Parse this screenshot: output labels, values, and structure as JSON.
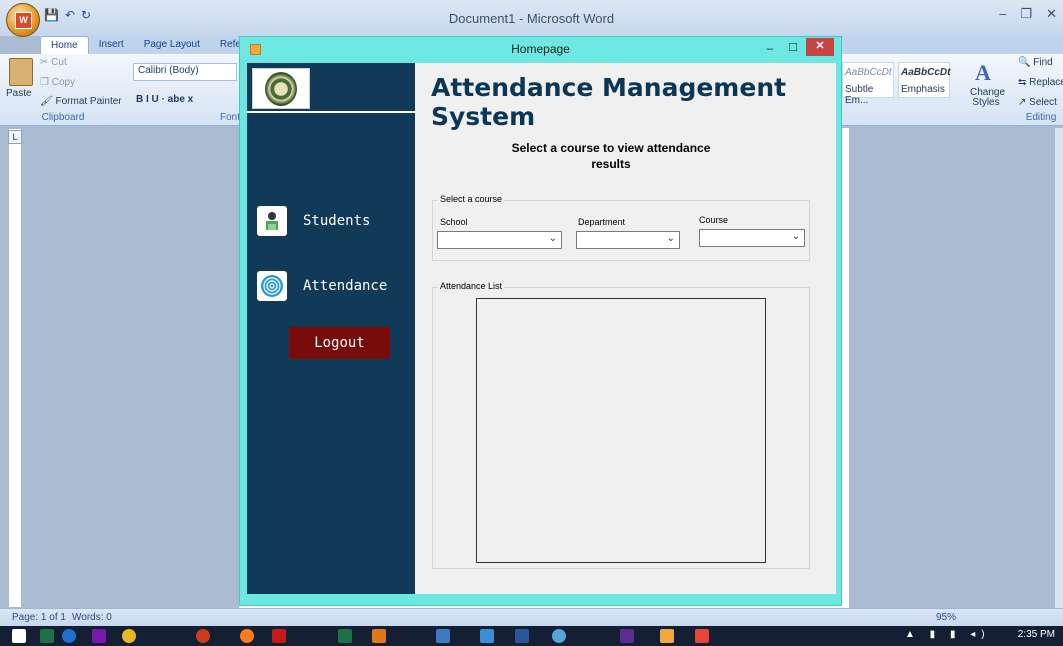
{
  "word": {
    "title": "Document1 - Microsoft Word",
    "office_logo": "W",
    "tabs": [
      "Home",
      "Insert",
      "Page Layout",
      "Refere"
    ],
    "clipboard": {
      "paste": "Paste",
      "cut": "Cut",
      "copy": "Copy",
      "format_painter": "Format Painter",
      "group_label": "Clipboard"
    },
    "font": {
      "name": "Calibri (Body)",
      "group_label": "Font",
      "format_buttons": "B  I  U · abe  x"
    },
    "styles": {
      "subtle": "Subtle Em...",
      "emphasis": "Emphasis",
      "sample": "AaBbCcDt",
      "change_styles": "Change Styles"
    },
    "editing": {
      "find": "Find",
      "replace": "Replace",
      "select": "Select",
      "group_label": "Editing"
    },
    "status": {
      "page": "Page: 1 of 1",
      "words": "Words: 0",
      "zoom": "95%"
    },
    "ruler_corner": "L",
    "clock": "2:35 PM"
  },
  "homepage": {
    "window_title": "Homepage",
    "app_title": "Attendance Management System",
    "instruction": "Select a course to view attendance results",
    "nav": {
      "students": "Students",
      "attendance": "Attendance",
      "logout": "Logout"
    },
    "select_group": {
      "legend": "Select a course",
      "school_label": "School",
      "department_label": "Department",
      "course_label": "Course"
    },
    "attendance_group": {
      "legend": "Attendance List"
    }
  },
  "colors": {
    "sidebar": "#113a58",
    "logout": "#7a0b0b",
    "window_border": "#6de7e2",
    "title_text": "#0b3656"
  }
}
